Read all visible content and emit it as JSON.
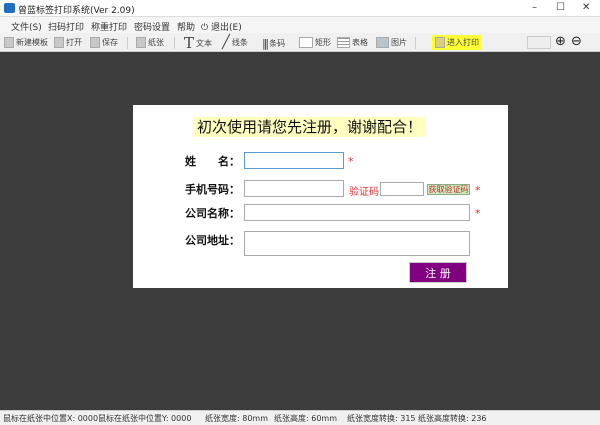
{
  "window": {
    "title": "曾蓝标签打印系统(Ver 2.09)",
    "minimize": "–",
    "maximize": "☐",
    "close": "✕"
  },
  "menu": [
    "文件(S)",
    "扫码打印",
    "称重打印",
    "密码设置",
    "帮助",
    "退出(E)"
  ],
  "toolbar": {
    "new": "新建模板",
    "open": "打开",
    "save": "保存",
    "paper": "纸张",
    "text": "文本",
    "line": "线条",
    "barcode": "条码",
    "rect": "矩形",
    "table": "表格",
    "image": "图片",
    "print": "进入打印",
    "highlight_color": "#ffff33"
  },
  "dialog": {
    "title": "初次使用请您先注册，谢谢配合！",
    "name_label": "姓　　名：",
    "phone_label": "手机号码：",
    "code_label": "验证码",
    "get_code": "获取验证码",
    "company_label": "公司名称：",
    "address_label": "公司地址：",
    "required": "*",
    "register": "注 册",
    "register_color": "#800080"
  },
  "status": {
    "mouse_x": "鼠标在纸张中位置X: 0000",
    "mouse_y": "鼠标在纸张中位置Y: 0000",
    "width": "纸张宽度: 80mm",
    "height": "纸张高度: 60mm",
    "width_conv": "纸张宽度转换: 315",
    "height_conv": "纸张高度转换: 236"
  }
}
